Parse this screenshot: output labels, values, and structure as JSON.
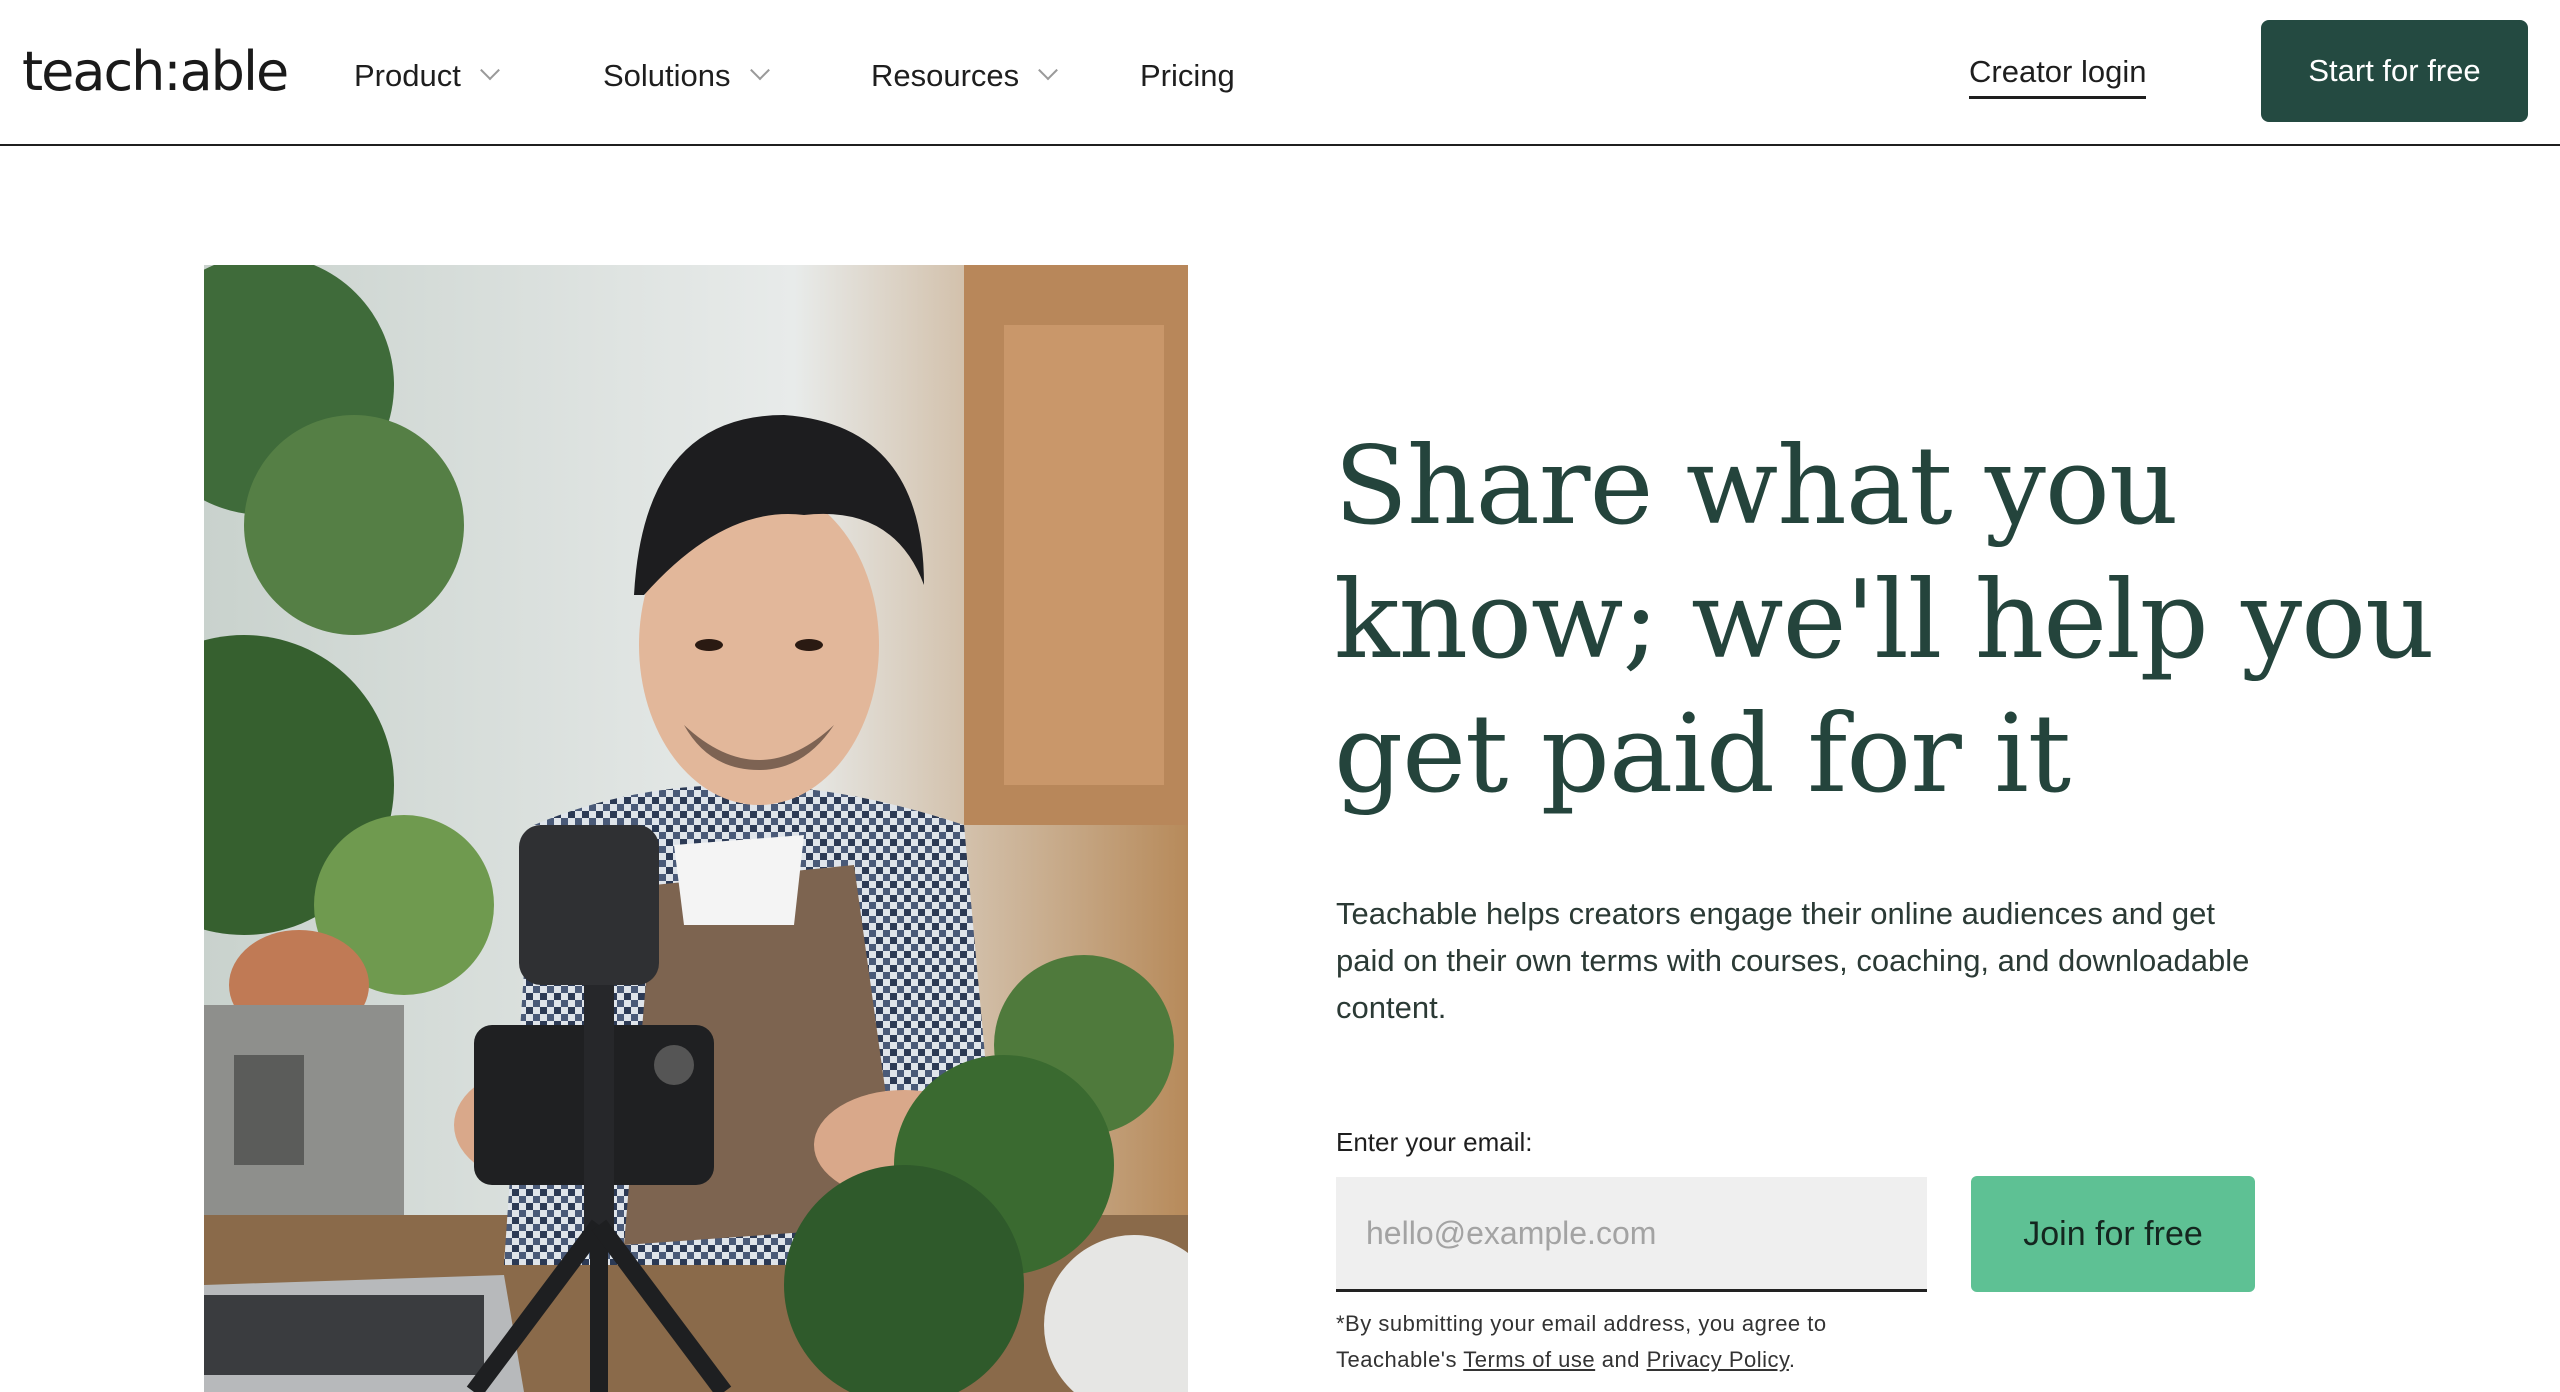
{
  "nav": {
    "logo": "teach:able",
    "items": [
      {
        "label": "Product",
        "has_dropdown": true
      },
      {
        "label": "Solutions",
        "has_dropdown": true
      },
      {
        "label": "Resources",
        "has_dropdown": true
      },
      {
        "label": "Pricing",
        "has_dropdown": false
      }
    ],
    "creator_login": "Creator login",
    "cta": "Start for free"
  },
  "hero": {
    "image_icon": "photo-creator-filming-plants",
    "headline": "Share what you know; we'll help you get paid for it",
    "subtext": "Teachable helps creators engage their online audiences and get paid on their own terms with courses, coaching, and downloadable content.",
    "email_label": "Enter your email:",
    "email_value": "",
    "email_placeholder": "hello@example.com",
    "join_label": "Join for free",
    "disclaimer_prefix": "*By submitting your email address, you agree to Teachable's ",
    "terms_link": "Terms of use",
    "disclaimer_and": " and ",
    "privacy_link": "Privacy Policy",
    "disclaimer_suffix": "."
  },
  "colors": {
    "brand_dark": "#244a41",
    "brand_green": "#5ec194",
    "headline": "#24443c"
  }
}
